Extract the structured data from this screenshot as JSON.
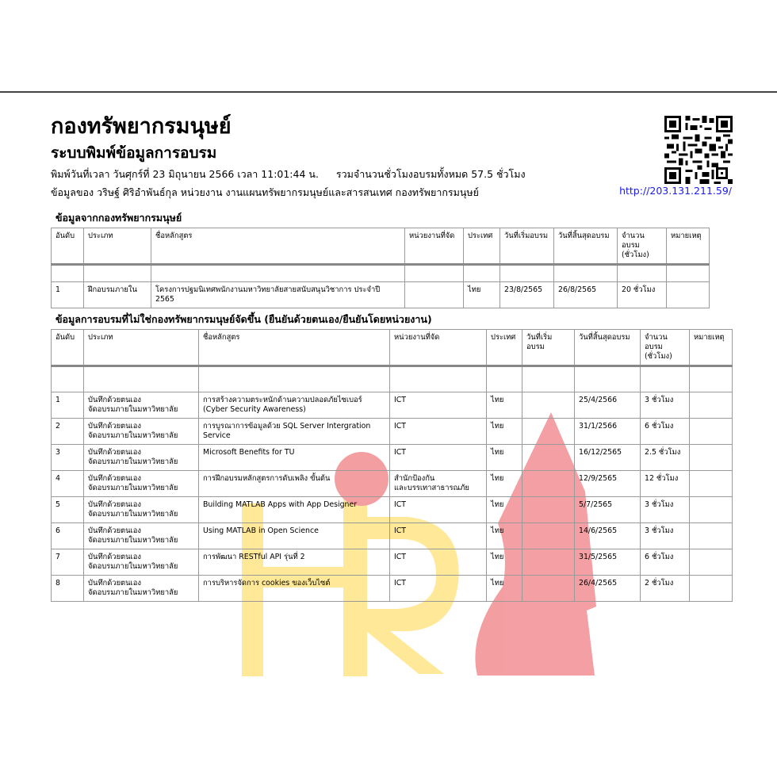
{
  "header": {
    "title": "กองทรัพยากรมนุษย์",
    "subtitle": "ระบบพิมพ์ข้อมูลการอบรม",
    "printed_at": "พิมพ์วันที่เวลา วันศุกร์ที่ 23 มิถุนายน 2566 เวลา 11:01:44 น.",
    "total_hours": "รวมจำนวนชั่วโมงอบรมทั้งหมด 57.5 ชั่วโมง",
    "owner": "ข้อมูลของ วริษฐ์ ศิริอำพันธ์กุล หน่วยงาน งานแผนทรัพยากรมนุษย์และสารสนเทศ กองทรัพยากรมนุษย์",
    "url": "http://203.131.211.59/",
    "qr_icon": "qr-code-icon"
  },
  "section1": {
    "title": "ข้อมูลจากกองทรัพยากรมนุษย์",
    "columns": [
      "อันดับ",
      "ประเภท",
      "ชื่อหลักสูตร",
      "หน่วยงานที่จัด",
      "ประเทศ",
      "วันที่เริ่มอบรม",
      "วันที่สิ้นสุดอบรม",
      "จำนวนอบรม\n(ชั่วโมง)",
      "หมายเหตุ"
    ],
    "rows": [
      [
        "1",
        "ฝึกอบรมภายใน",
        "โครงการปฐมนิเทศพนักงานมหาวิทยาลัยสายสนับสนุนวิชาการ ประจำปี 2565",
        "",
        "ไทย",
        "23/8/2565",
        "26/8/2565",
        "20 ชั่วโมง",
        ""
      ]
    ]
  },
  "section2": {
    "title": "ข้อมูลการอบรมที่ไม่ใช่กองทรัพยากรมนุษย์จัดขึ้น (ยืนยันด้วยตนเอง/ยืนยันโดยหน่วยงาน)",
    "columns": [
      "อันดับ",
      "ประเภท",
      "ชื่อหลักสูตร",
      "หน่วยงานที่จัด",
      "ประเทศ",
      "วันที่เริ่มอบรม",
      "วันที่สิ้นสุดอบรม",
      "จำนวนอบรม\n(ชั่วโมง)",
      "หมายเหตุ"
    ],
    "rows": [
      [
        "1",
        "บันทึกด้วยตนเอง\nจัดอบรมภายในมหาวิทยาลัย",
        "การสร้างความตระหนักด้านความปลอดภัยไซเบอร์\n(Cyber Security Awareness)",
        "ICT",
        "ไทย",
        "",
        "25/4/2566",
        "3 ชั่วโมง",
        ""
      ],
      [
        "2",
        "บันทึกด้วยตนเอง\nจัดอบรมภายในมหาวิทยาลัย",
        "การบูรณาการข้อมูลด้วย SQL Server Intergration\nService",
        "ICT",
        "ไทย",
        "",
        "31/1/2566",
        "6 ชั่วโมง",
        ""
      ],
      [
        "3",
        "บันทึกด้วยตนเอง\nจัดอบรมภายในมหาวิทยาลัย",
        "Microsoft Benefits for TU",
        "ICT",
        "ไทย",
        "",
        "16/12/2565",
        "2.5 ชั่วโมง",
        ""
      ],
      [
        "4",
        "บันทึกด้วยตนเอง\nจัดอบรมภายในมหาวิทยาลัย",
        "การฝึกอบรมหลักสูตรการดับเพลิง ขั้นต้น",
        "สำนักป้องกัน\nและบรรเทาสาธารณภัย",
        "ไทย",
        "",
        "12/9/2565",
        "12 ชั่วโมง",
        ""
      ],
      [
        "5",
        "บันทึกด้วยตนเอง\nจัดอบรมภายในมหาวิทยาลัย",
        "Building MATLAB Apps with App Designer",
        "ICT",
        "ไทย",
        "",
        "5/7/2565",
        "3 ชั่วโมง",
        ""
      ],
      [
        "6",
        "บันทึกด้วยตนเอง\nจัดอบรมภายในมหาวิทยาลัย",
        "Using MATLAB in Open Science",
        "ICT",
        "ไทย",
        "",
        "14/6/2565",
        "3 ชั่วโมง",
        ""
      ],
      [
        "7",
        "บันทึกด้วยตนเอง\nจัดอบรมภายในมหาวิทยาลัย",
        "การพัฒนา RESTful API รุ่นที่ 2",
        "ICT",
        "ไทย",
        "",
        "31/5/2565",
        "6 ชั่วโมง",
        ""
      ],
      [
        "8",
        "บันทึกด้วยตนเอง\nจัดอบรมภายในมหาวิทยาลัย",
        "การบริหารจัดการ cookies ของเว็บไซต์",
        "ICT",
        "ไทย",
        "",
        "26/4/2565",
        "2 ชั่วโมง",
        ""
      ]
    ]
  },
  "watermark": {
    "logo": "hr-logo-watermark",
    "yellow": "#ffe98a",
    "red": "#f08a8e"
  }
}
